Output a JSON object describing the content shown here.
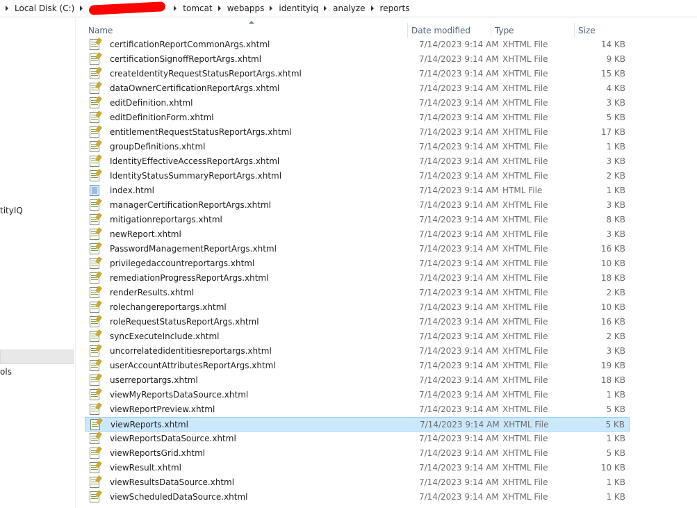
{
  "breadcrumb": {
    "items": [
      "Local Disk (C:)",
      "tomcat",
      "webapps",
      "identityiq",
      "analyze",
      "reports"
    ]
  },
  "nav": {
    "items": [
      {
        "label": "tityIQ"
      },
      {
        "label": "ols"
      }
    ]
  },
  "columns": {
    "name": "Name",
    "date": "Date modified",
    "type": "Type",
    "size": "Size"
  },
  "files": [
    {
      "name": "certificationReportCommonArgs.xhtml",
      "date": "7/14/2023 9:14 AM",
      "type": "XHTML File",
      "size": "14 KB",
      "icon": "xhtml-file-icon"
    },
    {
      "name": "certificationSignoffReportArgs.xhtml",
      "date": "7/14/2023 9:14 AM",
      "type": "XHTML File",
      "size": "9 KB",
      "icon": "xhtml-file-icon"
    },
    {
      "name": "createIdentityRequestStatusReportArgs.xhtml",
      "date": "7/14/2023 9:14 AM",
      "type": "XHTML File",
      "size": "15 KB",
      "icon": "xhtml-file-icon"
    },
    {
      "name": "dataOwnerCertificationReportArgs.xhtml",
      "date": "7/14/2023 9:14 AM",
      "type": "XHTML File",
      "size": "4 KB",
      "icon": "xhtml-file-icon"
    },
    {
      "name": "editDefinition.xhtml",
      "date": "7/14/2023 9:14 AM",
      "type": "XHTML File",
      "size": "3 KB",
      "icon": "xhtml-file-icon"
    },
    {
      "name": "editDefinitionForm.xhtml",
      "date": "7/14/2023 9:14 AM",
      "type": "XHTML File",
      "size": "5 KB",
      "icon": "xhtml-file-icon"
    },
    {
      "name": "entitlementRequestStatusReportArgs.xhtml",
      "date": "7/14/2023 9:14 AM",
      "type": "XHTML File",
      "size": "17 KB",
      "icon": "xhtml-file-icon"
    },
    {
      "name": "groupDefinitions.xhtml",
      "date": "7/14/2023 9:14 AM",
      "type": "XHTML File",
      "size": "1 KB",
      "icon": "xhtml-file-icon"
    },
    {
      "name": "IdentityEffectiveAccessReportArgs.xhtml",
      "date": "7/14/2023 9:14 AM",
      "type": "XHTML File",
      "size": "3 KB",
      "icon": "xhtml-file-icon"
    },
    {
      "name": "IdentityStatusSummaryReportArgs.xhtml",
      "date": "7/14/2023 9:14 AM",
      "type": "XHTML File",
      "size": "2 KB",
      "icon": "xhtml-file-icon"
    },
    {
      "name": "index.html",
      "date": "7/14/2023 9:14 AM",
      "type": "HTML File",
      "size": "1 KB",
      "icon": "html-file-icon"
    },
    {
      "name": "managerCertificationReportArgs.xhtml",
      "date": "7/14/2023 9:14 AM",
      "type": "XHTML File",
      "size": "3 KB",
      "icon": "xhtml-file-icon"
    },
    {
      "name": "mitigationreportargs.xhtml",
      "date": "7/14/2023 9:14 AM",
      "type": "XHTML File",
      "size": "8 KB",
      "icon": "xhtml-file-icon"
    },
    {
      "name": "newReport.xhtml",
      "date": "7/14/2023 9:14 AM",
      "type": "XHTML File",
      "size": "3 KB",
      "icon": "xhtml-file-icon"
    },
    {
      "name": "PasswordManagementReportArgs.xhtml",
      "date": "7/14/2023 9:14 AM",
      "type": "XHTML File",
      "size": "16 KB",
      "icon": "xhtml-file-icon"
    },
    {
      "name": "privilegedaccountreportargs.xhtml",
      "date": "7/14/2023 9:14 AM",
      "type": "XHTML File",
      "size": "10 KB",
      "icon": "xhtml-file-icon"
    },
    {
      "name": "remediationProgressReportArgs.xhtml",
      "date": "7/14/2023 9:14 AM",
      "type": "XHTML File",
      "size": "18 KB",
      "icon": "xhtml-file-icon"
    },
    {
      "name": "renderResults.xhtml",
      "date": "7/14/2023 9:14 AM",
      "type": "XHTML File",
      "size": "2 KB",
      "icon": "xhtml-file-icon"
    },
    {
      "name": "rolechangereportargs.xhtml",
      "date": "7/14/2023 9:14 AM",
      "type": "XHTML File",
      "size": "10 KB",
      "icon": "xhtml-file-icon"
    },
    {
      "name": "roleRequestStatusReportArgs.xhtml",
      "date": "7/14/2023 9:14 AM",
      "type": "XHTML File",
      "size": "16 KB",
      "icon": "xhtml-file-icon"
    },
    {
      "name": "syncExecuteInclude.xhtml",
      "date": "7/14/2023 9:14 AM",
      "type": "XHTML File",
      "size": "2 KB",
      "icon": "xhtml-file-icon"
    },
    {
      "name": "uncorrelatedidentitiesreportargs.xhtml",
      "date": "7/14/2023 9:14 AM",
      "type": "XHTML File",
      "size": "3 KB",
      "icon": "xhtml-file-icon"
    },
    {
      "name": "userAccountAttributesReportArgs.xhtml",
      "date": "7/14/2023 9:14 AM",
      "type": "XHTML File",
      "size": "19 KB",
      "icon": "xhtml-file-icon"
    },
    {
      "name": "userreportargs.xhtml",
      "date": "7/14/2023 9:14 AM",
      "type": "XHTML File",
      "size": "18 KB",
      "icon": "xhtml-file-icon"
    },
    {
      "name": "viewMyReportsDataSource.xhtml",
      "date": "7/14/2023 9:14 AM",
      "type": "XHTML File",
      "size": "1 KB",
      "icon": "xhtml-file-icon"
    },
    {
      "name": "viewReportPreview.xhtml",
      "date": "7/14/2023 9:14 AM",
      "type": "XHTML File",
      "size": "5 KB",
      "icon": "xhtml-file-icon"
    },
    {
      "name": "viewReports.xhtml",
      "date": "7/14/2023 9:14 AM",
      "type": "XHTML File",
      "size": "5 KB",
      "icon": "xhtml-file-icon",
      "selected": true
    },
    {
      "name": "viewReportsDataSource.xhtml",
      "date": "7/14/2023 9:14 AM",
      "type": "XHTML File",
      "size": "1 KB",
      "icon": "xhtml-file-icon"
    },
    {
      "name": "viewReportsGrid.xhtml",
      "date": "7/14/2023 9:14 AM",
      "type": "XHTML File",
      "size": "5 KB",
      "icon": "xhtml-file-icon"
    },
    {
      "name": "viewResult.xhtml",
      "date": "7/14/2023 9:14 AM",
      "type": "XHTML File",
      "size": "10 KB",
      "icon": "xhtml-file-icon"
    },
    {
      "name": "viewResultsDataSource.xhtml",
      "date": "7/14/2023 9:14 AM",
      "type": "XHTML File",
      "size": "1 KB",
      "icon": "xhtml-file-icon"
    },
    {
      "name": "viewScheduledDataSource.xhtml",
      "date": "7/14/2023 9:14 AM",
      "type": "XHTML File",
      "size": "1 KB",
      "icon": "xhtml-file-icon"
    }
  ],
  "colors": {
    "selection_bg": "#cce8ff",
    "selection_border": "#99d1ff",
    "header_text": "#4c607a",
    "redaction": "#ff0000"
  }
}
